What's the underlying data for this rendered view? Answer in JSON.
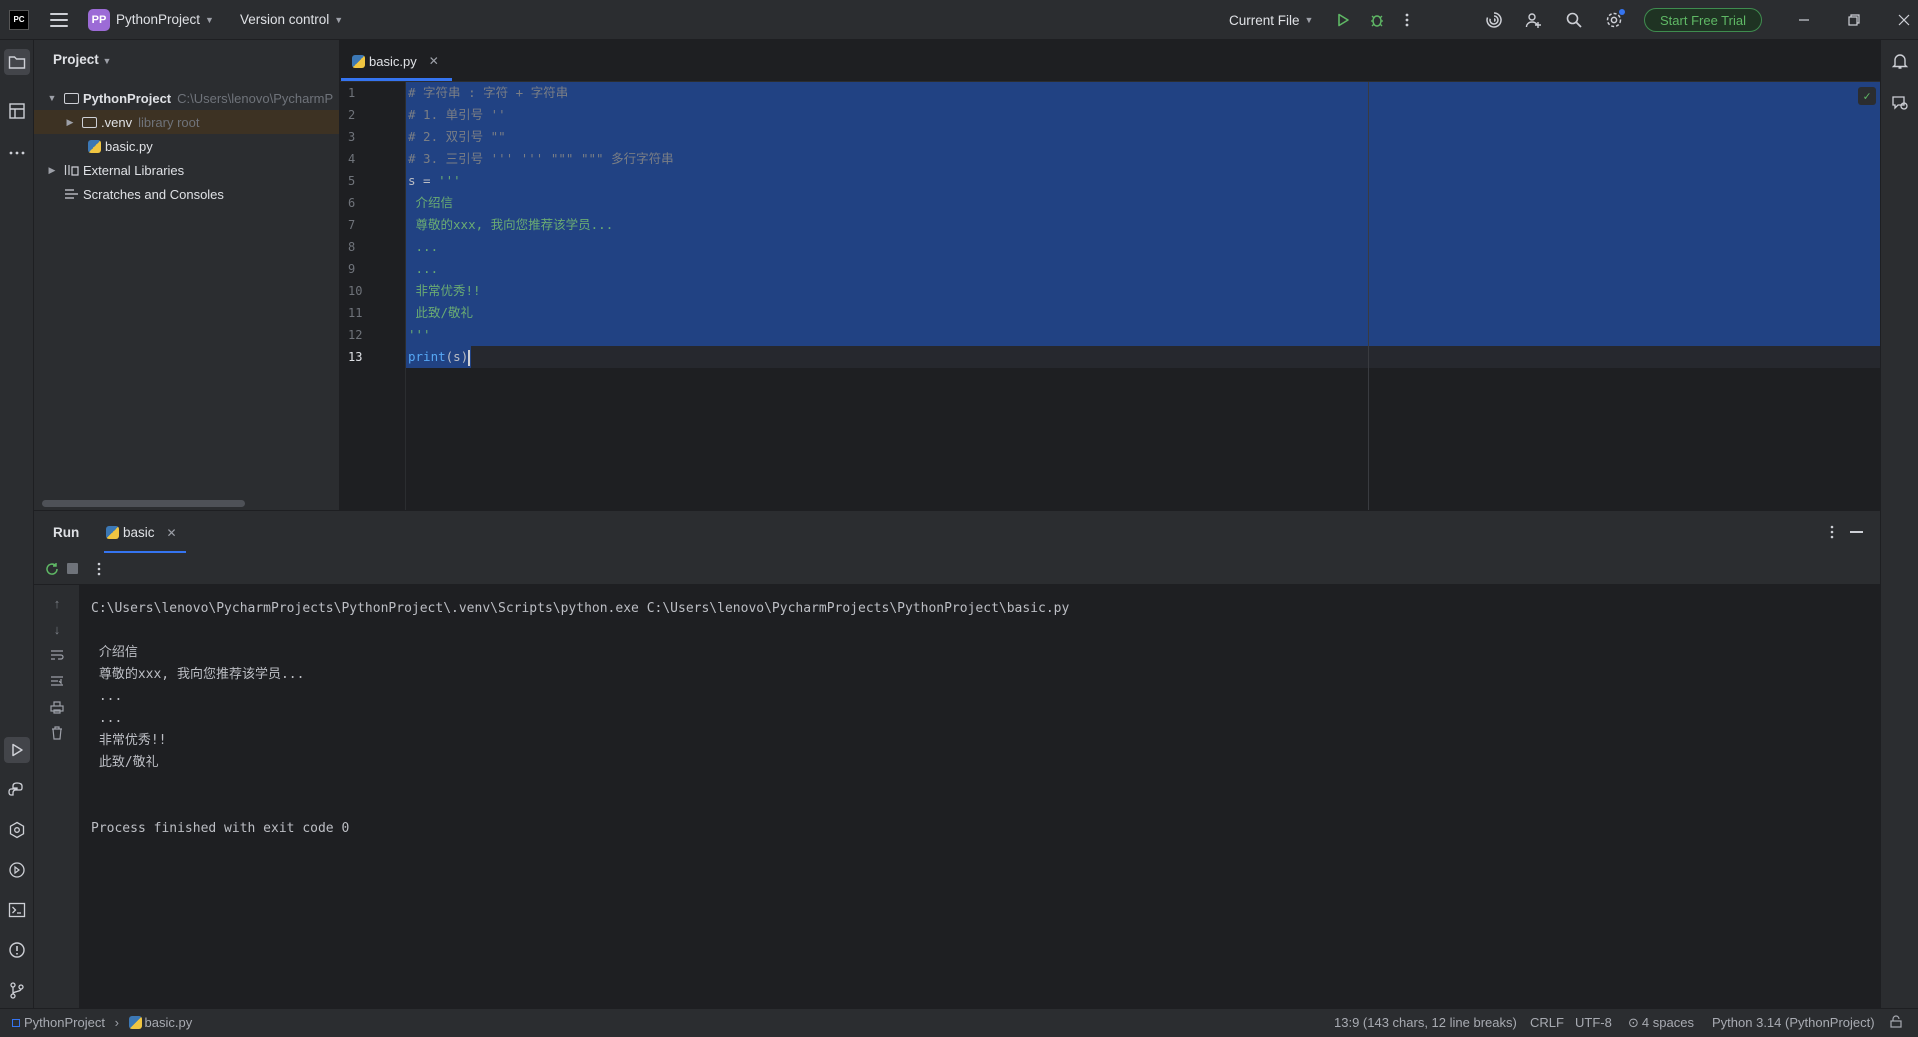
{
  "titlebar": {
    "app_icon": "pycharm-icon",
    "menu_icon": "hamburger-menu-icon",
    "project_badge": "PP",
    "project_name": "PythonProject",
    "vcs_label": "Version control",
    "run_config": "Current File",
    "trial_button": "Start Free Trial"
  },
  "project_panel": {
    "title": "Project",
    "root_name": "PythonProject",
    "root_path": "C:\\Users\\lenovo\\PycharmP",
    "venv_name": ".venv",
    "venv_hint": "library root",
    "file_name": "basic.py",
    "ext_libs": "External Libraries",
    "scratches": "Scratches and Consoles"
  },
  "editor": {
    "tab_name": "basic.py",
    "line_numbers": [
      "1",
      "2",
      "3",
      "4",
      "5",
      "6",
      "7",
      "8",
      "9",
      "10",
      "11",
      "12",
      "13"
    ],
    "lines": [
      "# 字符串 : 字符 + 字符串",
      "# 1. 单引号 ''",
      "# 2. 双引号 \"\"",
      "# 3. 三引号 ''' ''' \"\"\" \"\"\" 多行字符串",
      "s = '''",
      " 介绍信",
      " 尊敬的xxx, 我向您推荐该学员...",
      " ...",
      " ...",
      " 非常优秀!!",
      " 此致/敬礼",
      "'''",
      "print(s)"
    ],
    "s_assign": "s = ",
    "triple_quote": "'''",
    "print_fn": "print",
    "print_args": "(s)"
  },
  "run_panel": {
    "title": "Run",
    "tab_name": "basic",
    "command": "C:\\Users\\lenovo\\PycharmProjects\\PythonProject\\.venv\\Scripts\\python.exe C:\\Users\\lenovo\\PycharmProjects\\PythonProject\\basic.py",
    "output": [
      " 介绍信",
      " 尊敬的xxx, 我向您推荐该学员...",
      " ...",
      " ...",
      " 非常优秀!!",
      " 此致/敬礼"
    ],
    "exit_message": "Process finished with exit code 0"
  },
  "statusbar": {
    "crumb_project": "PythonProject",
    "crumb_file": "basic.py",
    "position": "13:9 (143 chars, 12 line breaks)",
    "line_sep": "CRLF",
    "encoding": "UTF-8",
    "indent": "4 spaces",
    "interpreter": "Python 3.14 (PythonProject)"
  },
  "colors": {
    "accent": "#3574f0",
    "selection": "#214283",
    "trial_green": "#5fb865"
  }
}
